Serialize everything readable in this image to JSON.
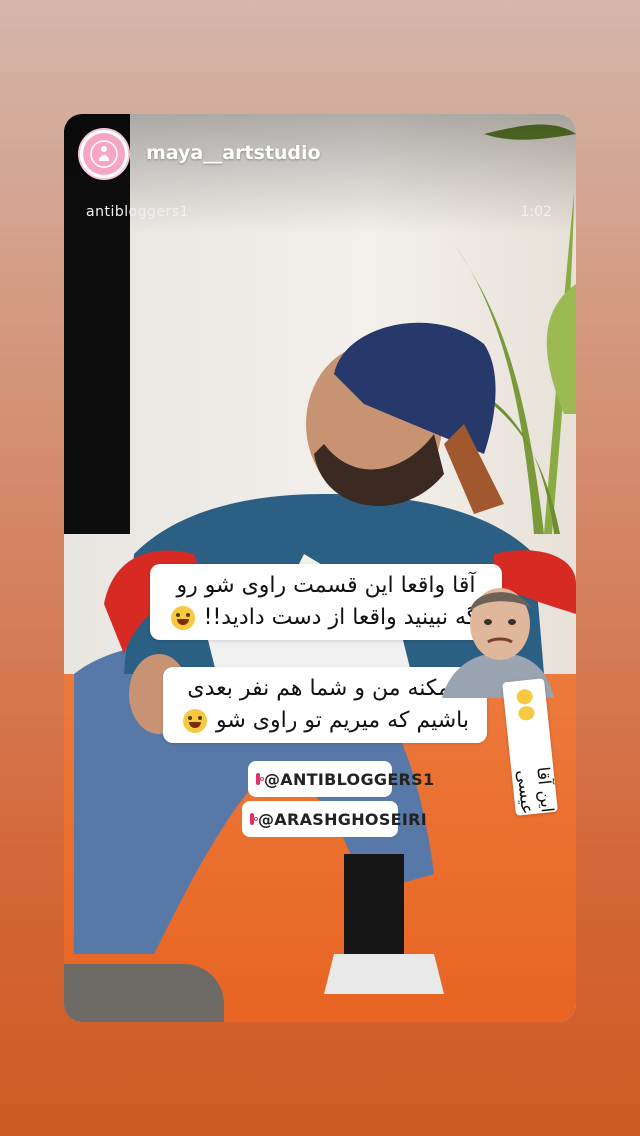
{
  "story": {
    "username": "maya__artstudio",
    "avatar_label": "MAYA ART STUDIO",
    "video_user": "antibloggers1",
    "video_time": "1:02"
  },
  "captions": {
    "bubble1_line1": "آقا واقعا این قسمت راوی شو رو",
    "bubble1_line2": "اگه نبینید واقعا از دست دادید!!",
    "bubble2_line1": "ممکنه من و شما هم نفر بعدی",
    "bubble2_line2": "باشیم که میریم تو راوی شو"
  },
  "mentions": [
    {
      "handle": "@ANTIBLOGGERS1"
    },
    {
      "handle": "@ARASHGHOSEIRI"
    }
  ],
  "sticker": {
    "tag_text": "این آقا عیسی"
  },
  "colors": {
    "bg_top": "#d4b6ab",
    "bg_bottom": "#cd5a22",
    "ig_pink": "#e1306c"
  }
}
